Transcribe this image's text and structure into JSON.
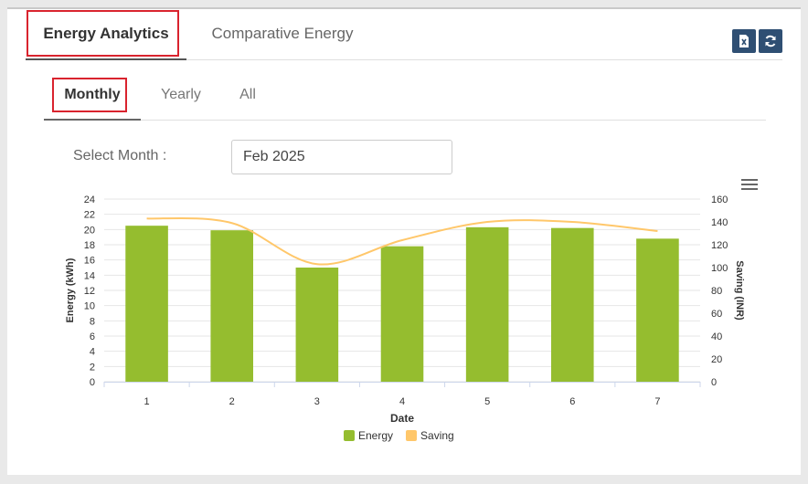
{
  "tabs": [
    {
      "label": "Energy Analytics",
      "active": true
    },
    {
      "label": "Comparative Energy",
      "active": false
    }
  ],
  "toolbar": {
    "export_icon": "excel-export-icon",
    "refresh_icon": "refresh-icon"
  },
  "subtabs": [
    {
      "label": "Monthly",
      "active": true
    },
    {
      "label": "Yearly",
      "active": false
    },
    {
      "label": "All",
      "active": false
    }
  ],
  "filter": {
    "label": "Select Month :",
    "value": "Feb 2025"
  },
  "colors": {
    "energy": "#95bd2f",
    "saving": "#ffc76a",
    "highlight": "#d9232e",
    "button": "#2f4f73"
  },
  "chart_data": {
    "type": "bar",
    "categories": [
      "1",
      "2",
      "3",
      "4",
      "5",
      "6",
      "7"
    ],
    "series": [
      {
        "name": "Energy",
        "type": "bar",
        "axis": "left",
        "values": [
          20.5,
          19.9,
          15.0,
          17.8,
          20.3,
          20.2,
          18.8
        ]
      },
      {
        "name": "Saving",
        "type": "line",
        "axis": "right",
        "values": [
          143,
          139,
          103,
          124,
          140,
          140,
          132
        ]
      }
    ],
    "xlabel": "Date",
    "ylabel": "Energy (kWh)",
    "y2label": "Saving (INR)",
    "ylim": [
      0,
      24
    ],
    "y2lim": [
      0,
      160
    ],
    "yticks": [
      "0",
      "2",
      "4",
      "6",
      "8",
      "10",
      "12",
      "14",
      "16",
      "18",
      "20",
      "22",
      "24"
    ],
    "y2ticks": [
      "0",
      "20",
      "40",
      "60",
      "80",
      "100",
      "120",
      "140",
      "160"
    ],
    "grid": true,
    "legend": "bottom-center"
  }
}
